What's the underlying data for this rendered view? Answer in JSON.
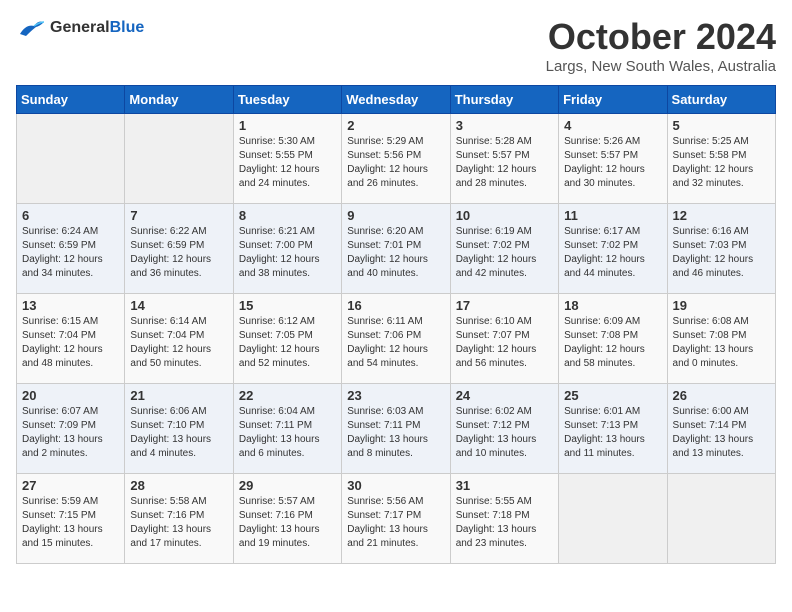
{
  "logo": {
    "line1": "General",
    "line2": "Blue"
  },
  "title": "October 2024",
  "subtitle": "Largs, New South Wales, Australia",
  "weekdays": [
    "Sunday",
    "Monday",
    "Tuesday",
    "Wednesday",
    "Thursday",
    "Friday",
    "Saturday"
  ],
  "weeks": [
    [
      {
        "day": "",
        "info": ""
      },
      {
        "day": "",
        "info": ""
      },
      {
        "day": "1",
        "info": "Sunrise: 5:30 AM\nSunset: 5:55 PM\nDaylight: 12 hours\nand 24 minutes."
      },
      {
        "day": "2",
        "info": "Sunrise: 5:29 AM\nSunset: 5:56 PM\nDaylight: 12 hours\nand 26 minutes."
      },
      {
        "day": "3",
        "info": "Sunrise: 5:28 AM\nSunset: 5:57 PM\nDaylight: 12 hours\nand 28 minutes."
      },
      {
        "day": "4",
        "info": "Sunrise: 5:26 AM\nSunset: 5:57 PM\nDaylight: 12 hours\nand 30 minutes."
      },
      {
        "day": "5",
        "info": "Sunrise: 5:25 AM\nSunset: 5:58 PM\nDaylight: 12 hours\nand 32 minutes."
      }
    ],
    [
      {
        "day": "6",
        "info": "Sunrise: 6:24 AM\nSunset: 6:59 PM\nDaylight: 12 hours\nand 34 minutes."
      },
      {
        "day": "7",
        "info": "Sunrise: 6:22 AM\nSunset: 6:59 PM\nDaylight: 12 hours\nand 36 minutes."
      },
      {
        "day": "8",
        "info": "Sunrise: 6:21 AM\nSunset: 7:00 PM\nDaylight: 12 hours\nand 38 minutes."
      },
      {
        "day": "9",
        "info": "Sunrise: 6:20 AM\nSunset: 7:01 PM\nDaylight: 12 hours\nand 40 minutes."
      },
      {
        "day": "10",
        "info": "Sunrise: 6:19 AM\nSunset: 7:02 PM\nDaylight: 12 hours\nand 42 minutes."
      },
      {
        "day": "11",
        "info": "Sunrise: 6:17 AM\nSunset: 7:02 PM\nDaylight: 12 hours\nand 44 minutes."
      },
      {
        "day": "12",
        "info": "Sunrise: 6:16 AM\nSunset: 7:03 PM\nDaylight: 12 hours\nand 46 minutes."
      }
    ],
    [
      {
        "day": "13",
        "info": "Sunrise: 6:15 AM\nSunset: 7:04 PM\nDaylight: 12 hours\nand 48 minutes."
      },
      {
        "day": "14",
        "info": "Sunrise: 6:14 AM\nSunset: 7:04 PM\nDaylight: 12 hours\nand 50 minutes."
      },
      {
        "day": "15",
        "info": "Sunrise: 6:12 AM\nSunset: 7:05 PM\nDaylight: 12 hours\nand 52 minutes."
      },
      {
        "day": "16",
        "info": "Sunrise: 6:11 AM\nSunset: 7:06 PM\nDaylight: 12 hours\nand 54 minutes."
      },
      {
        "day": "17",
        "info": "Sunrise: 6:10 AM\nSunset: 7:07 PM\nDaylight: 12 hours\nand 56 minutes."
      },
      {
        "day": "18",
        "info": "Sunrise: 6:09 AM\nSunset: 7:08 PM\nDaylight: 12 hours\nand 58 minutes."
      },
      {
        "day": "19",
        "info": "Sunrise: 6:08 AM\nSunset: 7:08 PM\nDaylight: 13 hours\nand 0 minutes."
      }
    ],
    [
      {
        "day": "20",
        "info": "Sunrise: 6:07 AM\nSunset: 7:09 PM\nDaylight: 13 hours\nand 2 minutes."
      },
      {
        "day": "21",
        "info": "Sunrise: 6:06 AM\nSunset: 7:10 PM\nDaylight: 13 hours\nand 4 minutes."
      },
      {
        "day": "22",
        "info": "Sunrise: 6:04 AM\nSunset: 7:11 PM\nDaylight: 13 hours\nand 6 minutes."
      },
      {
        "day": "23",
        "info": "Sunrise: 6:03 AM\nSunset: 7:11 PM\nDaylight: 13 hours\nand 8 minutes."
      },
      {
        "day": "24",
        "info": "Sunrise: 6:02 AM\nSunset: 7:12 PM\nDaylight: 13 hours\nand 10 minutes."
      },
      {
        "day": "25",
        "info": "Sunrise: 6:01 AM\nSunset: 7:13 PM\nDaylight: 13 hours\nand 11 minutes."
      },
      {
        "day": "26",
        "info": "Sunrise: 6:00 AM\nSunset: 7:14 PM\nDaylight: 13 hours\nand 13 minutes."
      }
    ],
    [
      {
        "day": "27",
        "info": "Sunrise: 5:59 AM\nSunset: 7:15 PM\nDaylight: 13 hours\nand 15 minutes."
      },
      {
        "day": "28",
        "info": "Sunrise: 5:58 AM\nSunset: 7:16 PM\nDaylight: 13 hours\nand 17 minutes."
      },
      {
        "day": "29",
        "info": "Sunrise: 5:57 AM\nSunset: 7:16 PM\nDaylight: 13 hours\nand 19 minutes."
      },
      {
        "day": "30",
        "info": "Sunrise: 5:56 AM\nSunset: 7:17 PM\nDaylight: 13 hours\nand 21 minutes."
      },
      {
        "day": "31",
        "info": "Sunrise: 5:55 AM\nSunset: 7:18 PM\nDaylight: 13 hours\nand 23 minutes."
      },
      {
        "day": "",
        "info": ""
      },
      {
        "day": "",
        "info": ""
      }
    ]
  ]
}
